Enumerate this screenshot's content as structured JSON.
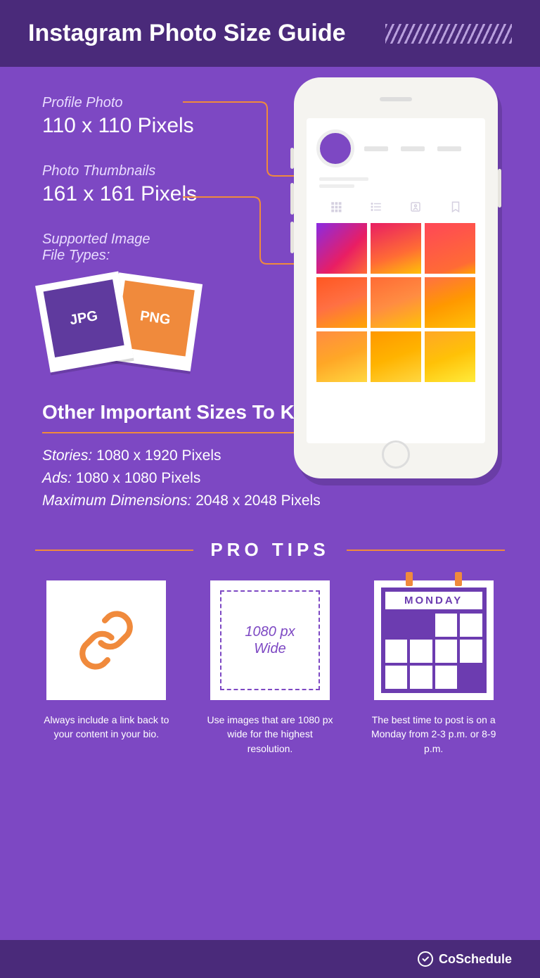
{
  "header": {
    "title": "Instagram Photo Size Guide"
  },
  "profile_photo": {
    "label": "Profile Photo",
    "value": "110 x 110 Pixels"
  },
  "thumbnails": {
    "label": "Photo Thumbnails",
    "value": "161 x 161 Pixels"
  },
  "filetypes": {
    "label": "Supported Image\nFile Types:",
    "jpg": "JPG",
    "png": "PNG"
  },
  "other_sizes": {
    "heading": "Other Important Sizes To Know",
    "stories_label": "Stories:",
    "stories_value": "1080 x 1920 Pixels",
    "ads_label": "Ads:",
    "ads_value": "1080 x 1080 Pixels",
    "max_label": "Maximum Dimensions:",
    "max_value": "2048 x 2048 Pixels"
  },
  "protips": {
    "heading": "PRO TIPS",
    "tip1": "Always include a link back to your content in your bio.",
    "tip2_card_l1": "1080 px",
    "tip2_card_l2": "Wide",
    "tip2": "Use images that are 1080 px wide for the highest resolution.",
    "tip3_card": "MONDAY",
    "tip3": "The best time to post is on a Monday from 2-3 p.m. or 8-9 p.m."
  },
  "footer": {
    "brand": "CoSchedule"
  }
}
